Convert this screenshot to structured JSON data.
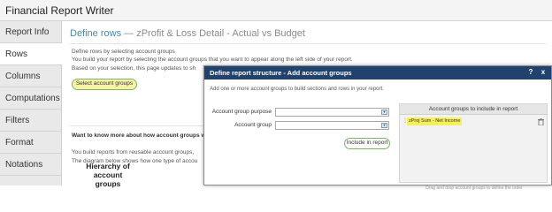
{
  "app": {
    "title": "Financial Report Writer"
  },
  "sidebar": {
    "items": [
      {
        "label": "Report Info"
      },
      {
        "label": "Rows"
      },
      {
        "label": "Columns"
      },
      {
        "label": "Computations"
      },
      {
        "label": "Filters"
      },
      {
        "label": "Format"
      },
      {
        "label": "Notations"
      }
    ]
  },
  "main": {
    "heading": "Define rows",
    "subheading": "— zProfit & Loss Detail - Actual vs Budget",
    "line1": "Define rows by selecting account groups",
    "line2": "You build your report by selecting the account groups that you want to appear along the left side of your report.",
    "line3": "Based on your selection, this page updates to sh",
    "select_button": "Select account groups",
    "more_heading": "Want to know more about how account groups w",
    "more_line1": "You build reports from reusable account groups,",
    "more_line2": "The diagram below shows how one type of accou",
    "hierarchy_title": "Hierarchy of account groups"
  },
  "modal": {
    "title": "Define report structure - Add account groups",
    "help": "?",
    "close": "x",
    "description": "Add one or more account groups to build sections and rows in your report.",
    "purpose_label": "Account group purpose",
    "purpose_value": "",
    "group_label": "Account group",
    "group_value": "",
    "include_button": "Include in report",
    "panel": {
      "header": "Account groups to include in report",
      "items": [
        {
          "label": "zProj Sum - Net Income"
        }
      ],
      "footer": "Drag and drop account groups to define the order"
    }
  }
}
